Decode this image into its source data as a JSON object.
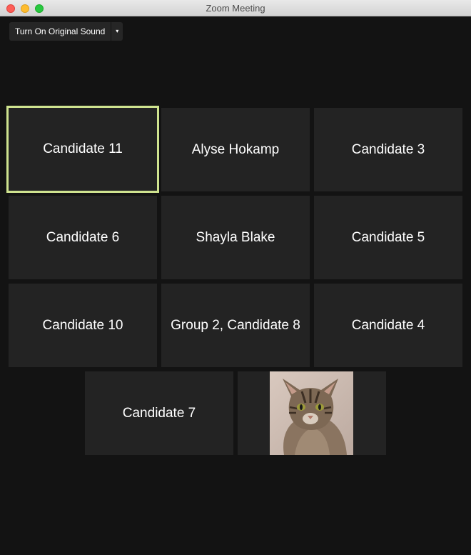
{
  "window": {
    "title": "Zoom Meeting"
  },
  "toolbar": {
    "original_sound_label": "Turn On Original Sound",
    "dropdown_icon": "▾"
  },
  "grid": {
    "tiles": [
      {
        "name": "Candidate 11",
        "active": true
      },
      {
        "name": "Alyse Hokamp"
      },
      {
        "name": "Candidate 3"
      },
      {
        "name": "Candidate 6"
      },
      {
        "name": "Shayla Blake"
      },
      {
        "name": "Candidate 5"
      },
      {
        "name": "Candidate 10"
      },
      {
        "name": "Group 2, Candidate 8"
      },
      {
        "name": "Candidate 4"
      },
      {
        "name": "Candidate 7"
      }
    ],
    "video_tile": {
      "content": "cat-photo"
    }
  },
  "colors": {
    "active_speaker_border": "#cfe38f",
    "tile_background": "#232323",
    "window_background": "#131313"
  }
}
